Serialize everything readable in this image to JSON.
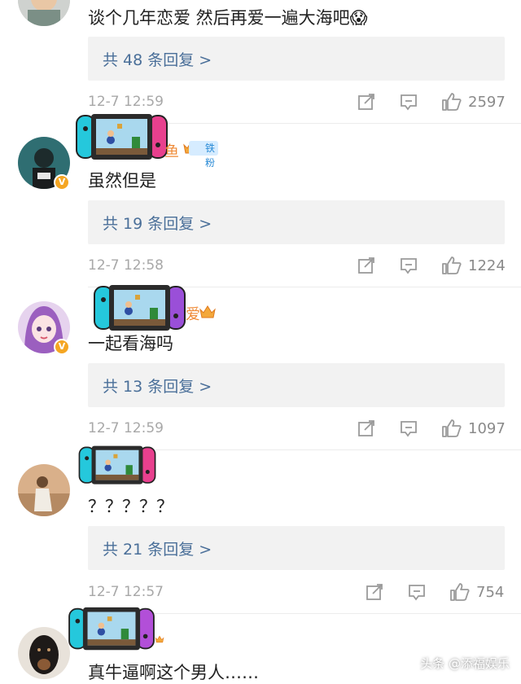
{
  "comments": [
    {
      "text": "谈个几年恋爱 然后再爱一遍大海吧😱",
      "replies": "共 48 条回复 >",
      "time": "12-7 12:59",
      "likes": "2597"
    },
    {
      "name_fragment": "鱼",
      "fan_badge": "铁粉",
      "text": "虽然但是",
      "replies": "共 19 条回复 >",
      "time": "12-7 12:58",
      "likes": "1224"
    },
    {
      "name_fragment": "爱",
      "text": "一起看海吗",
      "replies": "共 13 条回复 >",
      "time": "12-7 12:59",
      "likes": "1097"
    },
    {
      "text": "？？？？？",
      "replies": "共 21 条回复 >",
      "time": "12-7 12:57",
      "likes": "754"
    },
    {
      "text": "真牛逼啊这个男人……"
    }
  ],
  "watermark": "头条 @添福娱乐",
  "colors": {
    "link": "#4a6f99",
    "reply_bg": "#f2f2f2",
    "meta": "#a8a8a8",
    "name": "#ef8a36",
    "fan_badge_bg": "#d6ecff"
  }
}
